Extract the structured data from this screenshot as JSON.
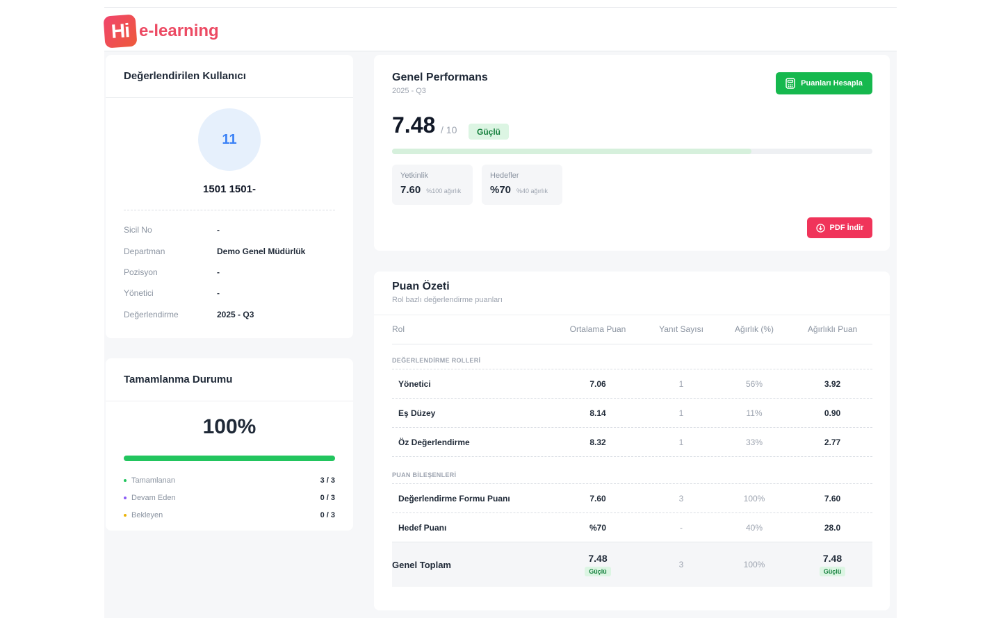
{
  "brand": {
    "logo_mark": "Hi",
    "logo_text": "e-learning"
  },
  "user_card": {
    "title": "Değerlendirilen Kullanıcı",
    "avatar_text": "11",
    "name": "1501 1501-",
    "fields": [
      {
        "label": "Sicil No",
        "value": "-"
      },
      {
        "label": "Departman",
        "value": "Demo Genel Müdürlük"
      },
      {
        "label": "Pozisyon",
        "value": "-"
      },
      {
        "label": "Yönetici",
        "value": "-"
      },
      {
        "label": "Değerlendirme",
        "value": "2025 - Q3"
      }
    ]
  },
  "completion": {
    "title": "Tamamlanma Durumu",
    "percent_text": "100%",
    "progress": 1.0,
    "legend": [
      {
        "label": "Tamamlanan",
        "value": "3 / 3",
        "color": "#22c55e"
      },
      {
        "label": "Devam Eden",
        "value": "0 / 3",
        "color": "#8b5cf6"
      },
      {
        "label": "Bekleyen",
        "value": "0 / 3",
        "color": "#eab308"
      }
    ]
  },
  "performance": {
    "title": "Genel Performans",
    "period": "2025 - Q3",
    "calc_button": "Puanları Hesapla",
    "score": "7.48",
    "score_max": "/ 10",
    "level": "Güçlü",
    "progress": 0.748,
    "metrics": [
      {
        "label": "Yetkinlik",
        "value": "7.60",
        "weight": "%100 ağırlık"
      },
      {
        "label": "Hedefler",
        "value": "%70",
        "weight": "%40 ağırlık"
      }
    ],
    "pdf_button": "PDF İndir",
    "colors": {
      "primary_green": "#16b84e",
      "pdf_red": "#f0345a"
    }
  },
  "summary": {
    "title": "Puan Özeti",
    "subtitle": "Rol bazlı değerlendirme puanları",
    "headers": [
      "Rol",
      "Ortalama Puan",
      "Yanıt Sayısı",
      "Ağırlık (%)",
      "Ağırlıklı Puan"
    ],
    "section_roles": "DEĞERLENDİRME ROLLERİ",
    "roles": [
      {
        "name": "Yönetici",
        "avg": "7.06",
        "count": "1",
        "weight": "56%",
        "weighted": "3.92"
      },
      {
        "name": "Eş Düzey",
        "avg": "8.14",
        "count": "1",
        "weight": "11%",
        "weighted": "0.90"
      },
      {
        "name": "Öz Değerlendirme",
        "avg": "8.32",
        "count": "1",
        "weight": "33%",
        "weighted": "2.77"
      }
    ],
    "section_components": "PUAN BİLEŞENLERİ",
    "components": [
      {
        "name": "Değerlendirme Formu Puanı",
        "avg": "7.60",
        "count": "3",
        "weight": "100%",
        "weighted": "7.60"
      },
      {
        "name": "Hedef Puanı",
        "avg": "%70",
        "count": "-",
        "weight": "40%",
        "weighted": "28.0"
      }
    ],
    "total": {
      "name": "Genel Toplam",
      "avg": "7.48",
      "avg_badge": "Güçlü",
      "count": "3",
      "weight": "100%",
      "weighted": "7.48",
      "weighted_badge": "Güçlü"
    }
  }
}
